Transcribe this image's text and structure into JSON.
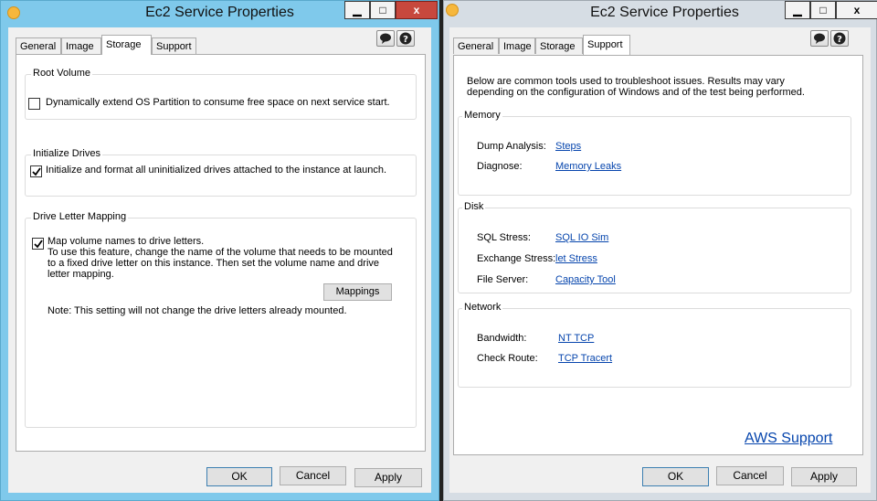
{
  "left": {
    "title": "Ec2 Service Properties",
    "tabs": [
      "General",
      "Image",
      "Storage",
      "Support"
    ],
    "active_tab": "Storage",
    "root_volume": {
      "label": "Root Volume",
      "checkbox_label": "Dynamically extend OS Partition to consume free space on next service start.",
      "checked": false
    },
    "initialize_drives": {
      "label": "Initialize Drives",
      "checkbox_label": "Initialize and format all uninitialized drives attached to the instance at launch.",
      "checked": true
    },
    "drive_letter_mapping": {
      "label": "Drive Letter Mapping",
      "checkbox_label": "Map volume names to drive letters.",
      "checked": true,
      "description": [
        "To use this feature, change the name of the volume that needs to be mounted",
        "to a fixed drive letter on this instance. Then set the volume name and drive",
        "letter mapping."
      ],
      "mappings_button": "Mappings",
      "note": "Note: This setting will not change the drive letters already mounted."
    },
    "buttons": {
      "ok": "OK",
      "cancel": "Cancel",
      "apply": "Apply"
    }
  },
  "right": {
    "title": "Ec2 Service Properties",
    "tabs": [
      "General",
      "Image",
      "Storage",
      "Support"
    ],
    "active_tab": "Support",
    "intro": [
      "Below are common tools used to troubleshoot issues. Results may vary",
      "depending on the configuration of Windows and of the test being performed."
    ],
    "memory": {
      "label": "Memory",
      "rows": [
        {
          "label": "Dump Analysis:",
          "link": "Steps"
        },
        {
          "label": "Diagnose:",
          "link": "Memory Leaks"
        }
      ]
    },
    "disk": {
      "label": "Disk",
      "rows": [
        {
          "label": "SQL Stress:",
          "link": "SQL IO Sim"
        },
        {
          "label": "Exchange Stress:",
          "link": "let Stress"
        },
        {
          "label": "File Server:",
          "link": "Capacity Tool"
        }
      ]
    },
    "network": {
      "label": "Network",
      "rows": [
        {
          "label": "Bandwidth:",
          "link": "NT TCP"
        },
        {
          "label": "Check Route:",
          "link": "TCP Tracert"
        }
      ]
    },
    "aws_support_link": "AWS Support",
    "buttons": {
      "ok": "OK",
      "cancel": "Cancel",
      "apply": "Apply"
    }
  },
  "window_buttons": {
    "minimize": "▁",
    "maximize": "□",
    "close": "x"
  }
}
